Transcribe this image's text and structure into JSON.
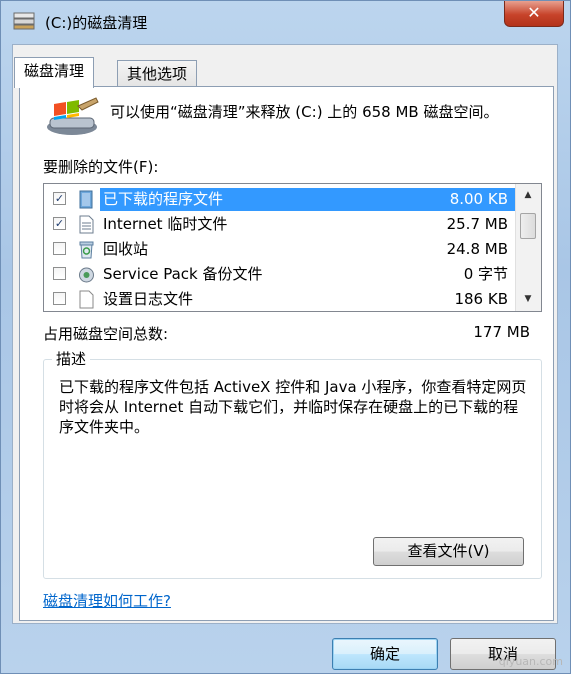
{
  "window": {
    "title": "(C:)的磁盘清理",
    "close_label": "✕"
  },
  "tabs": [
    {
      "label": "磁盘清理",
      "active": true
    },
    {
      "label": "其他选项",
      "active": false
    }
  ],
  "intro_text": "可以使用“磁盘清理”来释放  (C:) 上的 658 MB 磁盘空间。",
  "list": {
    "label": "要删除的文件(F):",
    "items": [
      {
        "name": "已下载的程序文件",
        "size": "8.00 KB",
        "checked": true,
        "selected": true,
        "icon": "folder-icon"
      },
      {
        "name": "Internet 临时文件",
        "size": "25.7 MB",
        "checked": true,
        "selected": false,
        "icon": "document-icon"
      },
      {
        "name": "回收站",
        "size": "24.8 MB",
        "checked": false,
        "selected": false,
        "icon": "recycle-bin-icon"
      },
      {
        "name": "Service Pack 备份文件",
        "size": "0 字节",
        "checked": false,
        "selected": false,
        "icon": "service-pack-icon"
      },
      {
        "name": "设置日志文件",
        "size": "186 KB",
        "checked": false,
        "selected": false,
        "icon": "blank-file-icon"
      }
    ]
  },
  "total": {
    "label": "占用磁盘空间总数:",
    "value": "177 MB"
  },
  "description": {
    "title": "描述",
    "text": "已下载的程序文件包括 ActiveX 控件和 Java 小程序，你查看特定网页时将会从 Internet 自动下载它们，并临时保存在硬盘上的已下载的程序文件夹中。"
  },
  "buttons": {
    "view_files": "查看文件(V)",
    "ok": "确定",
    "cancel": "取消"
  },
  "help_link": "磁盘清理如何工作?",
  "watermark": "qiyuan.com",
  "colors": {
    "selection": "#3399ff",
    "link": "#0066cc"
  }
}
